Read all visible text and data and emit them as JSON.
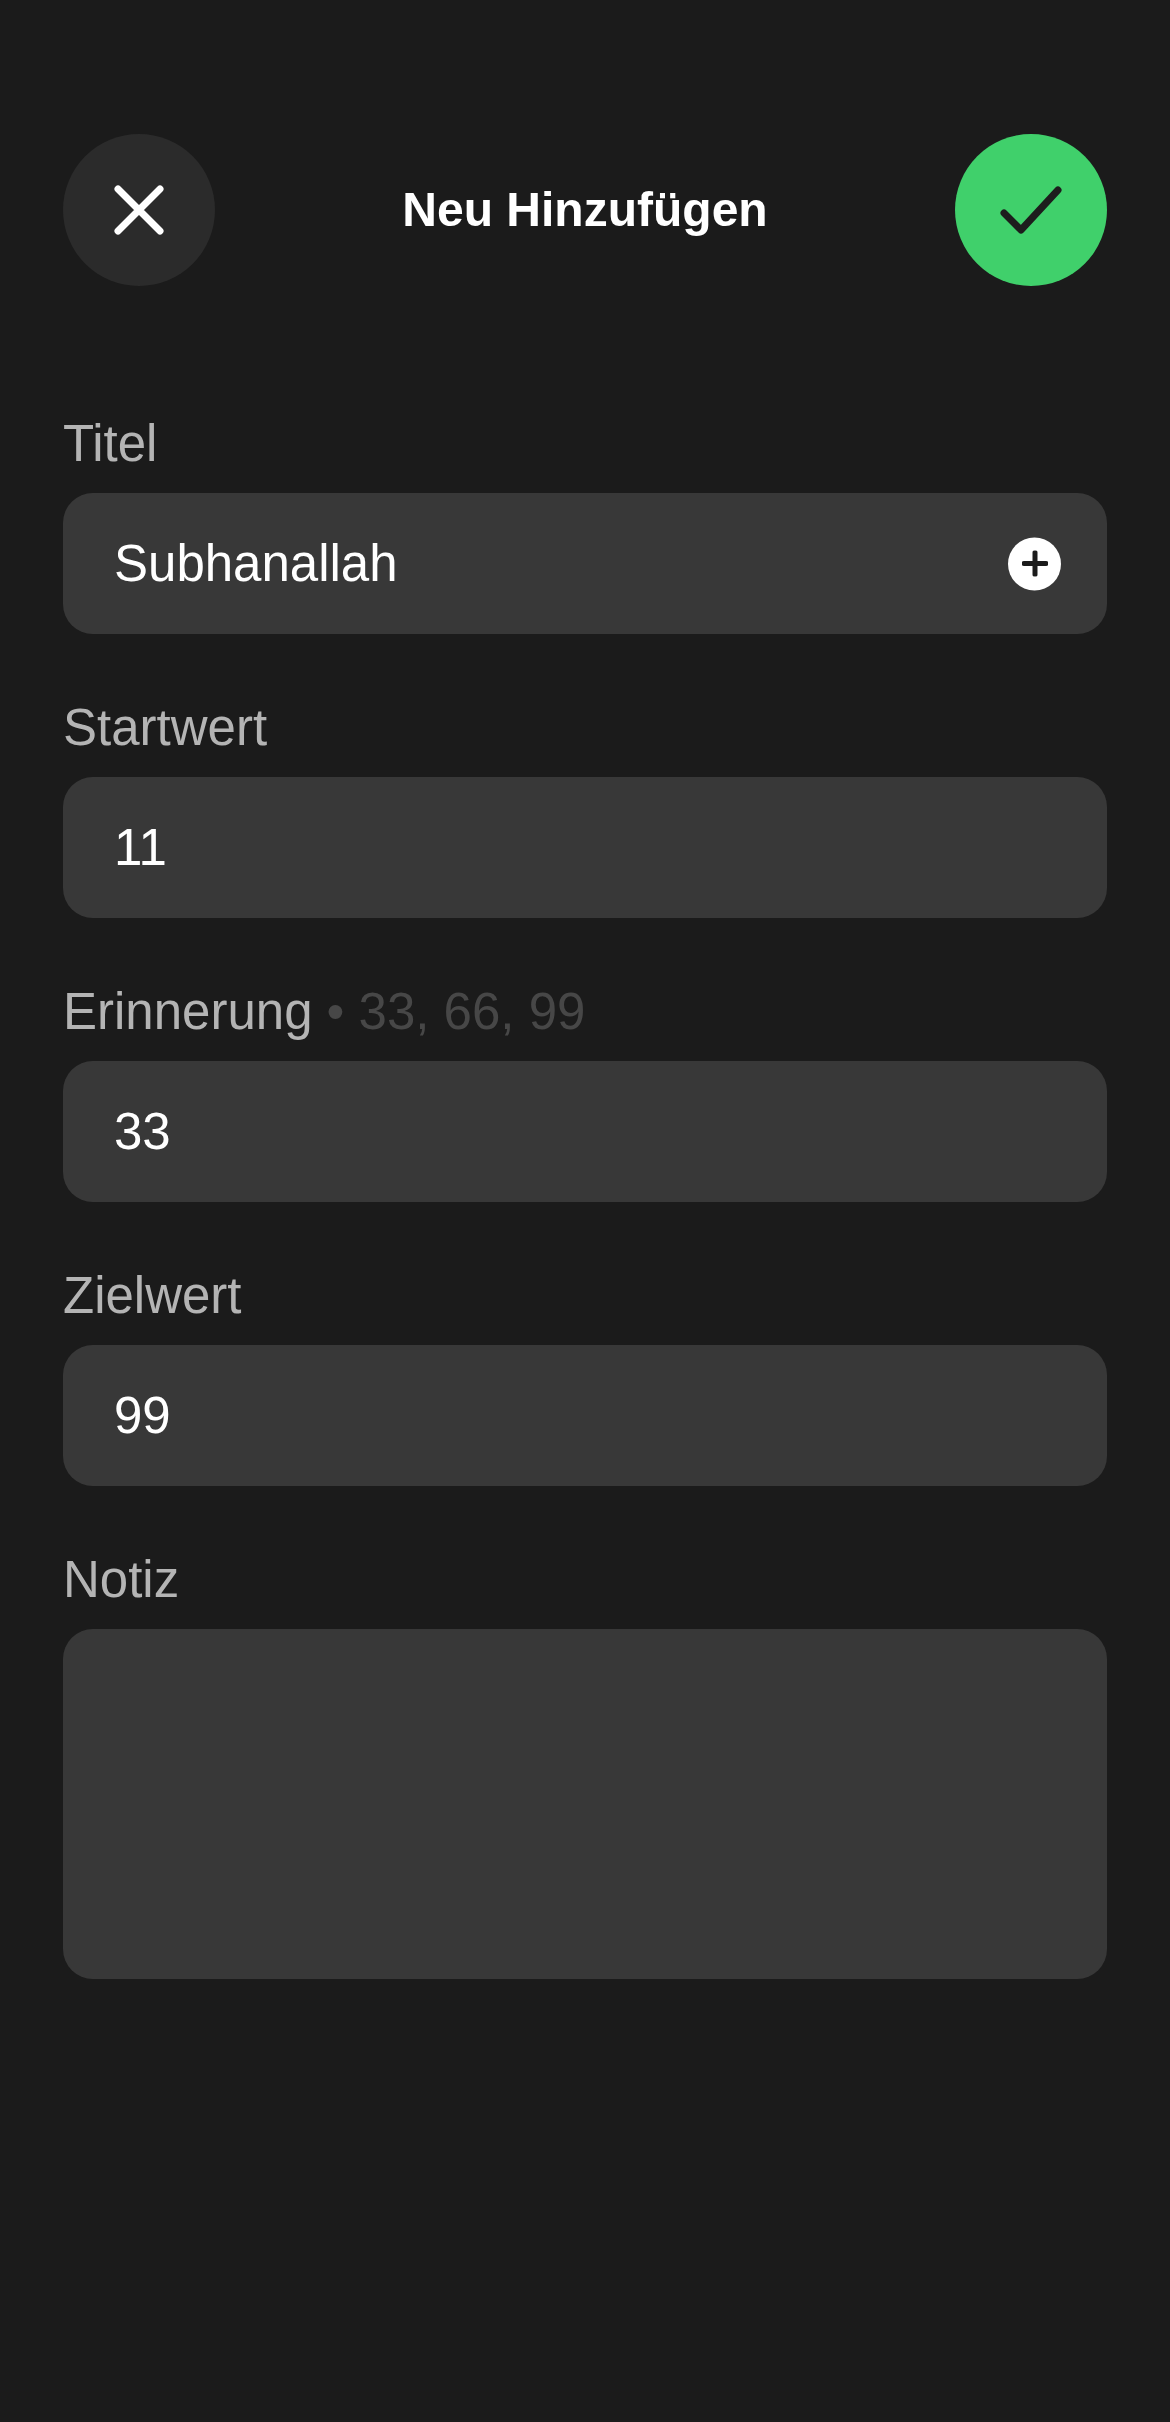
{
  "header": {
    "title": "Neu Hinzufügen"
  },
  "fields": [
    {
      "kind": "text_add",
      "label": "Titel",
      "value": "Subhanallah"
    },
    {
      "kind": "number",
      "label": "Startwert",
      "value": "11"
    },
    {
      "kind": "number",
      "label": "Erinnerung",
      "hint": "• 33, 66, 99",
      "value": "33"
    },
    {
      "kind": "number",
      "label": "Zielwert",
      "value": "99"
    },
    {
      "kind": "multiline",
      "label": "Notiz"
    }
  ]
}
